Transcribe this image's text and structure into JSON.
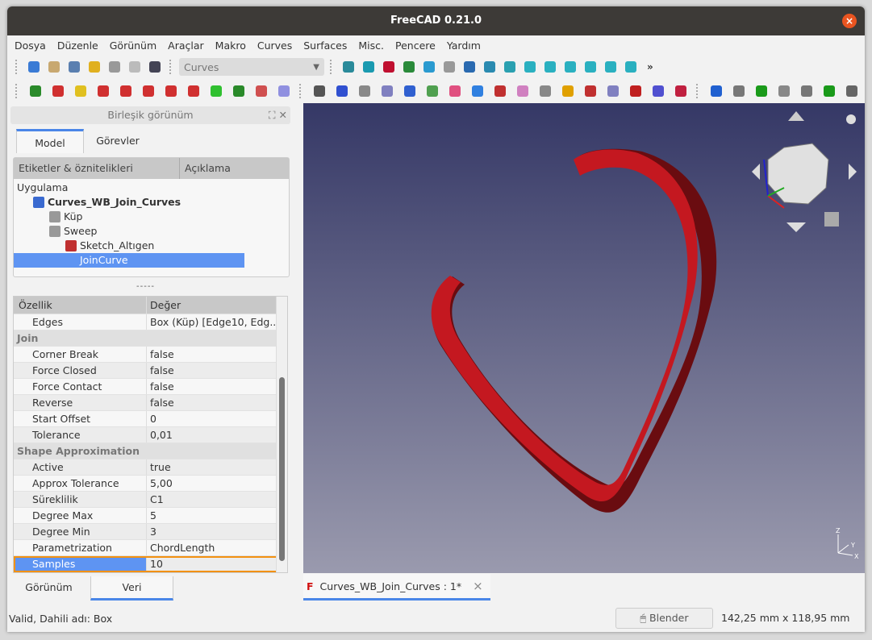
{
  "window": {
    "title": "FreeCAD 0.21.0",
    "close": "×"
  },
  "menu": [
    "Dosya",
    "Düzenle",
    "Görünüm",
    "Araçlar",
    "Makro",
    "Curves",
    "Surfaces",
    "Misc.",
    "Pencere",
    "Yardım"
  ],
  "toolbar": {
    "workbench": "Curves",
    "more": "»",
    "row1_icons": [
      [
        "new-document-icon",
        "#3a7bd5"
      ],
      [
        "open-icon",
        "#c8a870"
      ],
      [
        "save-icon",
        "#5a7fb0"
      ],
      [
        "undo-icon",
        "#e0b020"
      ],
      [
        "redo-icon",
        "#999"
      ],
      [
        "refresh-icon",
        "#bbb"
      ],
      [
        "whats-this-icon",
        "#445"
      ]
    ],
    "row1b_icons": [
      [
        "fit-all-icon",
        "#2a8a9a"
      ],
      [
        "fit-selection-icon",
        "#1a9ab0"
      ],
      [
        "draw-style-icon",
        "#c01030"
      ],
      [
        "bounding-box-icon",
        "#2a8a3a"
      ],
      [
        "back-icon",
        "#2a9ad0"
      ],
      [
        "forward-icon",
        "#999"
      ],
      [
        "std-view-icon",
        "#2a6ab0"
      ],
      [
        "zoom-icon",
        "#2a8ab0"
      ],
      [
        "isometric-icon",
        "#2aa0b0"
      ],
      [
        "front-view-icon",
        "#2ab0c0"
      ],
      [
        "top-view-icon",
        "#2ab0c0"
      ],
      [
        "right-view-icon",
        "#2ab0c0"
      ],
      [
        "rear-view-icon",
        "#2ab0c0"
      ],
      [
        "bottom-view-icon",
        "#2ab0c0"
      ],
      [
        "left-view-icon",
        "#2ab0c0"
      ]
    ],
    "row2_icons": [
      [
        "line-icon",
        "#2a8a2a"
      ],
      [
        "polyline-icon",
        "#d03030"
      ],
      [
        "editable-spline-icon",
        "#e0c020"
      ],
      [
        "join-curve-icon",
        "#d03030"
      ],
      [
        "discretize-icon",
        "#d03030"
      ],
      [
        "approximate-icon",
        "#d03030"
      ],
      [
        "interpolate-icon",
        "#d03030"
      ],
      [
        "offset-icon",
        "#d03030"
      ],
      [
        "blend-curve-icon",
        "#30c030"
      ],
      [
        "parabola-icon",
        "#2a8a2a"
      ],
      [
        "comb-icon",
        "#d05050"
      ],
      [
        "surface-icon",
        "#9090e0"
      ],
      [
        "zebra-icon",
        "#555"
      ],
      [
        "gordon-icon",
        "#3050d0"
      ],
      [
        "blend-surface-icon",
        "#888"
      ],
      [
        "map-icon",
        "#8080c0"
      ],
      [
        "face-icon",
        "#3060d0"
      ],
      [
        "pipeshell-icon",
        "#50a050"
      ],
      [
        "sweep-icon",
        "#e05080"
      ],
      [
        "pipe-icon",
        "#3080e0"
      ],
      [
        "segment-icon",
        "#c03030"
      ],
      [
        "trim-icon",
        "#d080c0"
      ],
      [
        "iso-icon",
        "#888"
      ],
      [
        "sphere-icon",
        "#e0a000"
      ],
      [
        "split-icon",
        "#c03030"
      ],
      [
        "ruled-icon",
        "#8080c0"
      ],
      [
        "hook-icon",
        "#c02020"
      ],
      [
        "reflect-icon",
        "#5050d0"
      ],
      [
        "corner-icon",
        "#c02040"
      ],
      [
        "info-icon",
        "#2060d0"
      ],
      [
        "box-icon",
        "#777"
      ],
      [
        "green-box-icon",
        "#1a9a1a"
      ],
      [
        "file-icon",
        "#888"
      ],
      [
        "gray-box-icon",
        "#777"
      ],
      [
        "grid-icon",
        "#1a9a1a"
      ],
      [
        "stairs-icon",
        "#666"
      ]
    ]
  },
  "combo_view": {
    "title": "Birleşik görünüm",
    "tabs": [
      "Model",
      "Görevler"
    ],
    "tree_headers": [
      "Etiketler & öznitelikleri",
      "Açıklama"
    ],
    "tree": [
      {
        "label": "Uygulama",
        "level": 0
      },
      {
        "label": "Curves_WB_Join_Curves",
        "level": 1,
        "bold": true
      },
      {
        "label": "Küp",
        "level": 2
      },
      {
        "label": "Sweep",
        "level": 2
      },
      {
        "label": "Sketch_Altıgen",
        "level": 3
      },
      {
        "label": "JoinCurve",
        "level": 3,
        "selected": true
      }
    ],
    "splitter": "-----"
  },
  "properties": {
    "headers": [
      "Özellik",
      "Değer"
    ],
    "rows": [
      {
        "k": "Edges",
        "v": "Box (Küp) [Edge10, Edg..."
      },
      {
        "group": "Join"
      },
      {
        "k": "Corner Break",
        "v": "false"
      },
      {
        "k": "Force Closed",
        "v": "false"
      },
      {
        "k": "Force Contact",
        "v": "false"
      },
      {
        "k": "Reverse",
        "v": "false"
      },
      {
        "k": "Start Offset",
        "v": "0"
      },
      {
        "k": "Tolerance",
        "v": "0,01"
      },
      {
        "group": "Shape Approximation"
      },
      {
        "k": "Active",
        "v": "true"
      },
      {
        "k": "Approx Tolerance",
        "v": "5,00"
      },
      {
        "k": "Süreklilik",
        "v": "C1"
      },
      {
        "k": "Degree Max",
        "v": "5"
      },
      {
        "k": "Degree Min",
        "v": "3"
      },
      {
        "k": "Parametrization",
        "v": "ChordLength"
      },
      {
        "k": "Samples",
        "v": "10",
        "selected": true
      }
    ]
  },
  "bottom_tabs": [
    "Görünüm",
    "Veri"
  ],
  "document_tab": {
    "label": "Curves_WB_Join_Curves : 1*",
    "close": "×"
  },
  "status": {
    "message": "Valid, Dahili adı: Box",
    "nav_style": "Blender",
    "dimensions": "142,25 mm x 118,95 mm"
  },
  "colors": {
    "accent": "#4a86e8",
    "selection": "#5e94f2",
    "highlight_border": "#f29111",
    "shape": "#c0141c"
  }
}
